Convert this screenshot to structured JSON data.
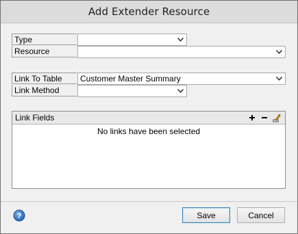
{
  "window": {
    "title": "Add Extender Resource"
  },
  "form": {
    "type_label": "Type",
    "type_value": "",
    "resource_label": "Resource",
    "resource_value": "",
    "link_to_table_label": "Link To Table",
    "link_to_table_value": "Customer Master Summary",
    "link_method_label": "Link Method",
    "link_method_value": ""
  },
  "link_fields": {
    "title": "Link Fields",
    "empty_message": "No links have been selected",
    "tools": [
      "plus-icon",
      "minus-icon",
      "edit-pencil-icon"
    ]
  },
  "footer": {
    "help_icon": "help-icon",
    "save_label": "Save",
    "cancel_label": "Cancel"
  }
}
